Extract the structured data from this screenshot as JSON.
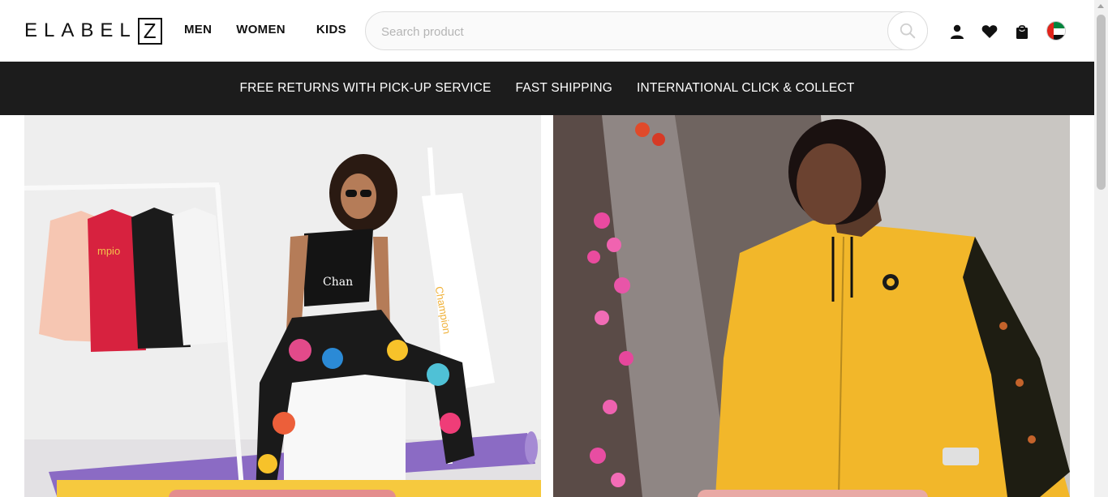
{
  "brand": {
    "logo_text": "ELABEL",
    "logo_box": "Z"
  },
  "nav": {
    "items": [
      "MEN",
      "WOMEN",
      "KIDS"
    ]
  },
  "search": {
    "placeholder": "Search product",
    "value": ""
  },
  "header_icons": [
    "search-icon",
    "user-icon",
    "heart-icon",
    "bag-icon",
    "uae-flag-icon"
  ],
  "promo": {
    "items": [
      "FREE RETURNS WITH PICK-UP SERVICE",
      "FAST SHIPPING",
      "INTERNATIONAL CLICK & COLLECT"
    ]
  },
  "hero": {
    "left": {
      "print_text": "Champion"
    },
    "right": {}
  },
  "colors": {
    "promo_bg": "#1c1c1c",
    "accent_yellow": "#f2b72a",
    "text": "#111111"
  }
}
